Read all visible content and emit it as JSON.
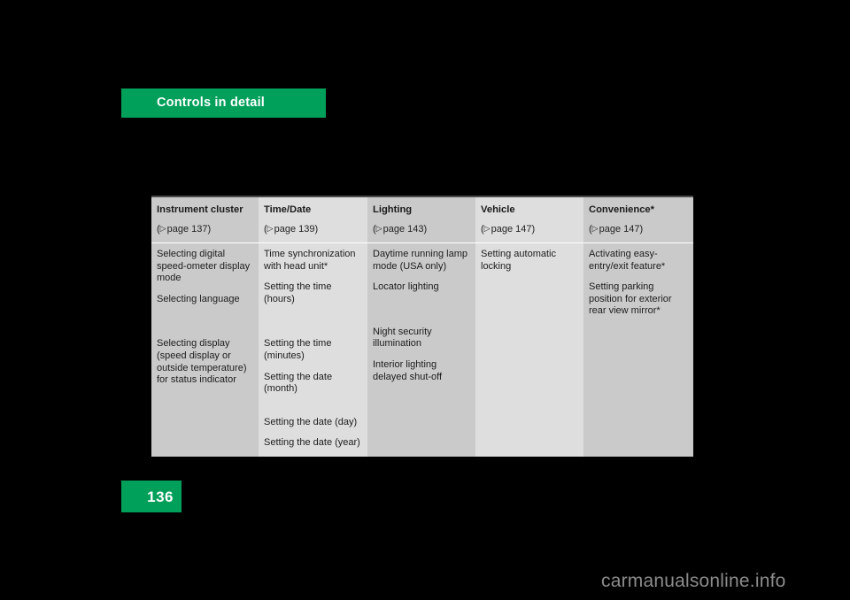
{
  "chapter": {
    "banner_label": "Controls in detail",
    "banner_color": "#00a05a"
  },
  "page": {
    "number": "136",
    "number_box_color": "#00a05a"
  },
  "watermark": {
    "text": "carmanualsonline.info",
    "color": "#8c8c8c"
  },
  "table": {
    "header_bg": "#cacaca",
    "shade_dark": "#cacaca",
    "shade_light": "#dedede",
    "ref_arrow": "▷",
    "columns": [
      {
        "title": "Instrument cluster",
        "page_ref": "( page 137)",
        "page_ref_prefix": "(",
        "page_ref_text": "page 137)",
        "shade": "dark",
        "items": [
          "Selecting digital speed-ometer display mode",
          "Selecting language",
          "Selecting display (speed display or outside temperature) for status indicator"
        ]
      },
      {
        "title": "Time/Date",
        "page_ref_prefix": "(",
        "page_ref_text": "page 139)",
        "shade": "light",
        "items": [
          "Time synchronization with head unit*",
          "Setting the time (hours)",
          "Setting the time (minutes)",
          "Setting the date (month)",
          "Setting the date (day)",
          "Setting the date (year)"
        ]
      },
      {
        "title": "Lighting",
        "page_ref_prefix": "(",
        "page_ref_text": "page 143)",
        "shade": "dark",
        "items": [
          "Daytime running lamp mode (USA only)",
          "Locator lighting",
          "Night security illumination",
          "Interior lighting delayed shut-off"
        ]
      },
      {
        "title": "Vehicle",
        "page_ref_prefix": "(",
        "page_ref_text": "page 147)",
        "shade": "light",
        "items": [
          "Setting automatic locking"
        ]
      },
      {
        "title": "Convenience*",
        "page_ref_prefix": "(",
        "page_ref_text": "page 147)",
        "shade": "dark",
        "items": [
          "Activating easy-entry/exit feature*",
          "Setting parking position for exterior rear view mirror*"
        ]
      }
    ]
  }
}
